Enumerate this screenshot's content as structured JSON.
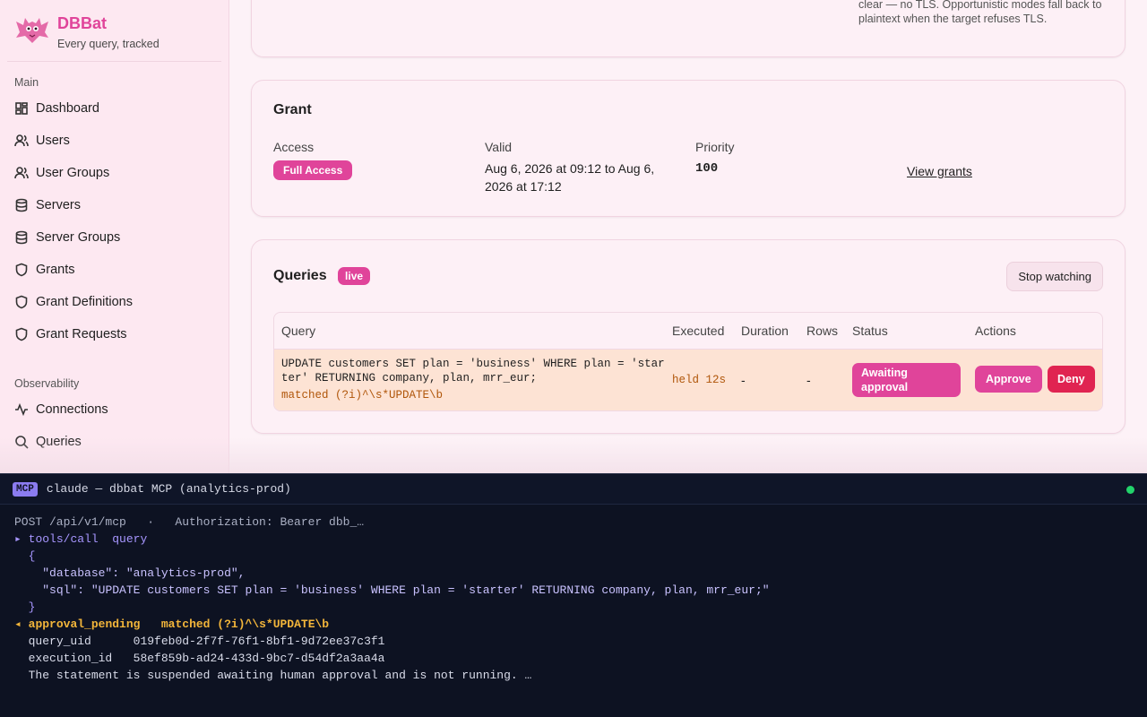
{
  "brand": {
    "name": "DBBat",
    "tagline": "Every query, tracked"
  },
  "sidebar": {
    "sections": [
      {
        "label": "Main",
        "items": [
          {
            "label": "Dashboard",
            "icon": "dashboard-icon"
          },
          {
            "label": "Users",
            "icon": "users-icon"
          },
          {
            "label": "User Groups",
            "icon": "user-groups-icon"
          },
          {
            "label": "Servers",
            "icon": "database-icon"
          },
          {
            "label": "Server Groups",
            "icon": "database-icon"
          },
          {
            "label": "Grants",
            "icon": "shield-icon"
          },
          {
            "label": "Grant Definitions",
            "icon": "shield-icon"
          },
          {
            "label": "Grant Requests",
            "icon": "shield-icon"
          }
        ]
      },
      {
        "label": "Observability",
        "items": [
          {
            "label": "Connections",
            "icon": "activity-icon"
          },
          {
            "label": "Queries",
            "icon": "search-icon"
          }
        ]
      }
    ]
  },
  "tls_card": {
    "note": "The proxy→database leg of this session ran in the clear — no TLS. Opportunistic modes fall back to plaintext when the target refuses TLS."
  },
  "grant": {
    "title": "Grant",
    "access_label": "Access",
    "access_value": "Full Access",
    "valid_label": "Valid",
    "valid_value": "Aug 6, 2026 at 09:12 to Aug 6, 2026 at 17:12",
    "priority_label": "Priority",
    "priority_value": "100",
    "view_grants": "View grants"
  },
  "queries": {
    "title": "Queries",
    "live_badge": "live",
    "stop_button": "Stop watching",
    "columns": [
      "Query",
      "Executed",
      "Duration",
      "Rows",
      "Status",
      "Actions"
    ],
    "rows": [
      {
        "sql": "UPDATE customers SET plan = 'business' WHERE plan = 'starter' RETURNING company, plan, mrr_eur;",
        "matched": "matched (?i)^\\s*UPDATE\\b",
        "executed": "held 12s",
        "duration": "-",
        "rows": "-",
        "status": "Awaiting approval",
        "approve": "Approve",
        "deny": "Deny"
      }
    ]
  },
  "terminal": {
    "tag": "MCP",
    "title": "claude — dbbat MCP (analytics-prod)",
    "status_color": "#22d36b",
    "request_line": "POST /api/v1/mcp   ·   Authorization: Bearer dbb_…",
    "call_marker": "▸",
    "call": "tools/call  query",
    "open_brace": "{",
    "database_key": "\"database\":",
    "database_value": "\"analytics-prod\",",
    "sql_key": "\"sql\":",
    "sql_value": "\"UPDATE customers SET plan = 'business' WHERE plan = 'starter' RETURNING company, plan, mrr_eur;\"",
    "close_brace": "}",
    "resp_marker": "◂",
    "resp_status": "approval_pending",
    "resp_matched": "matched (?i)^\\s*UPDATE\\b",
    "query_uid_label": "query_uid",
    "query_uid": "019feb0d-2f7f-76f1-8bf1-9d72ee37c3f1",
    "execution_id_label": "execution_id",
    "execution_id": "58ef859b-ad24-433d-9bc7-d54df2a3aa4a",
    "message": "The statement is suspended awaiting human approval and is not running. …"
  }
}
